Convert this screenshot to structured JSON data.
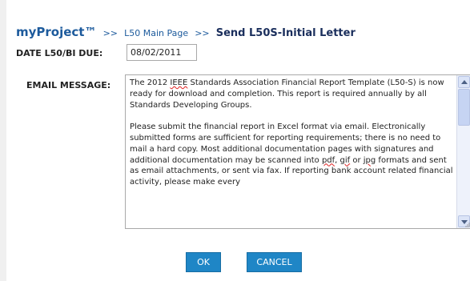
{
  "breadcrumb": {
    "brand": "myProject™",
    "separator": ">>",
    "parent_link": "L50 Main Page",
    "current": "Send L50S-Initial Letter"
  },
  "form": {
    "date_label": "DATE L50/BI DUE:",
    "date_value": "08/02/2011",
    "email_label": "EMAIL MESSAGE:",
    "email_paragraphs": [
      {
        "before": "The 2012 ",
        "flagged": "IEEE",
        "after": " Standards Association Financial Report Template (L50-S) is now ready for download and completion. This report is required annually by all Standards Developing Groups."
      },
      {
        "p2_a": "Please submit the financial report in Excel format via email. Electronically submitted forms are sufficient for reporting requirements; there is no need to mail a hard copy. Most additional documentation pages with signatures and additional documentation may be scanned into ",
        "p2_pdf": "pdf",
        "p2_b": ", ",
        "p2_gif": "gif",
        "p2_c": " or ",
        "p2_jpg": "jpg",
        "p2_d": " formats and sent as email attachments, or sent via fax. If reporting bank account related financial activity, please make every"
      }
    ]
  },
  "buttons": {
    "ok": "OK",
    "cancel": "CANCEL"
  },
  "colors": {
    "link_blue": "#1c5a9c",
    "title_navy": "#1a2e5c",
    "button_blue": "#1f86c6",
    "spellcheck_red": "#e02020"
  },
  "icons": {
    "scroll_up": "triangle-up",
    "scroll_down": "triangle-down",
    "resize": "diagonal-grip"
  }
}
